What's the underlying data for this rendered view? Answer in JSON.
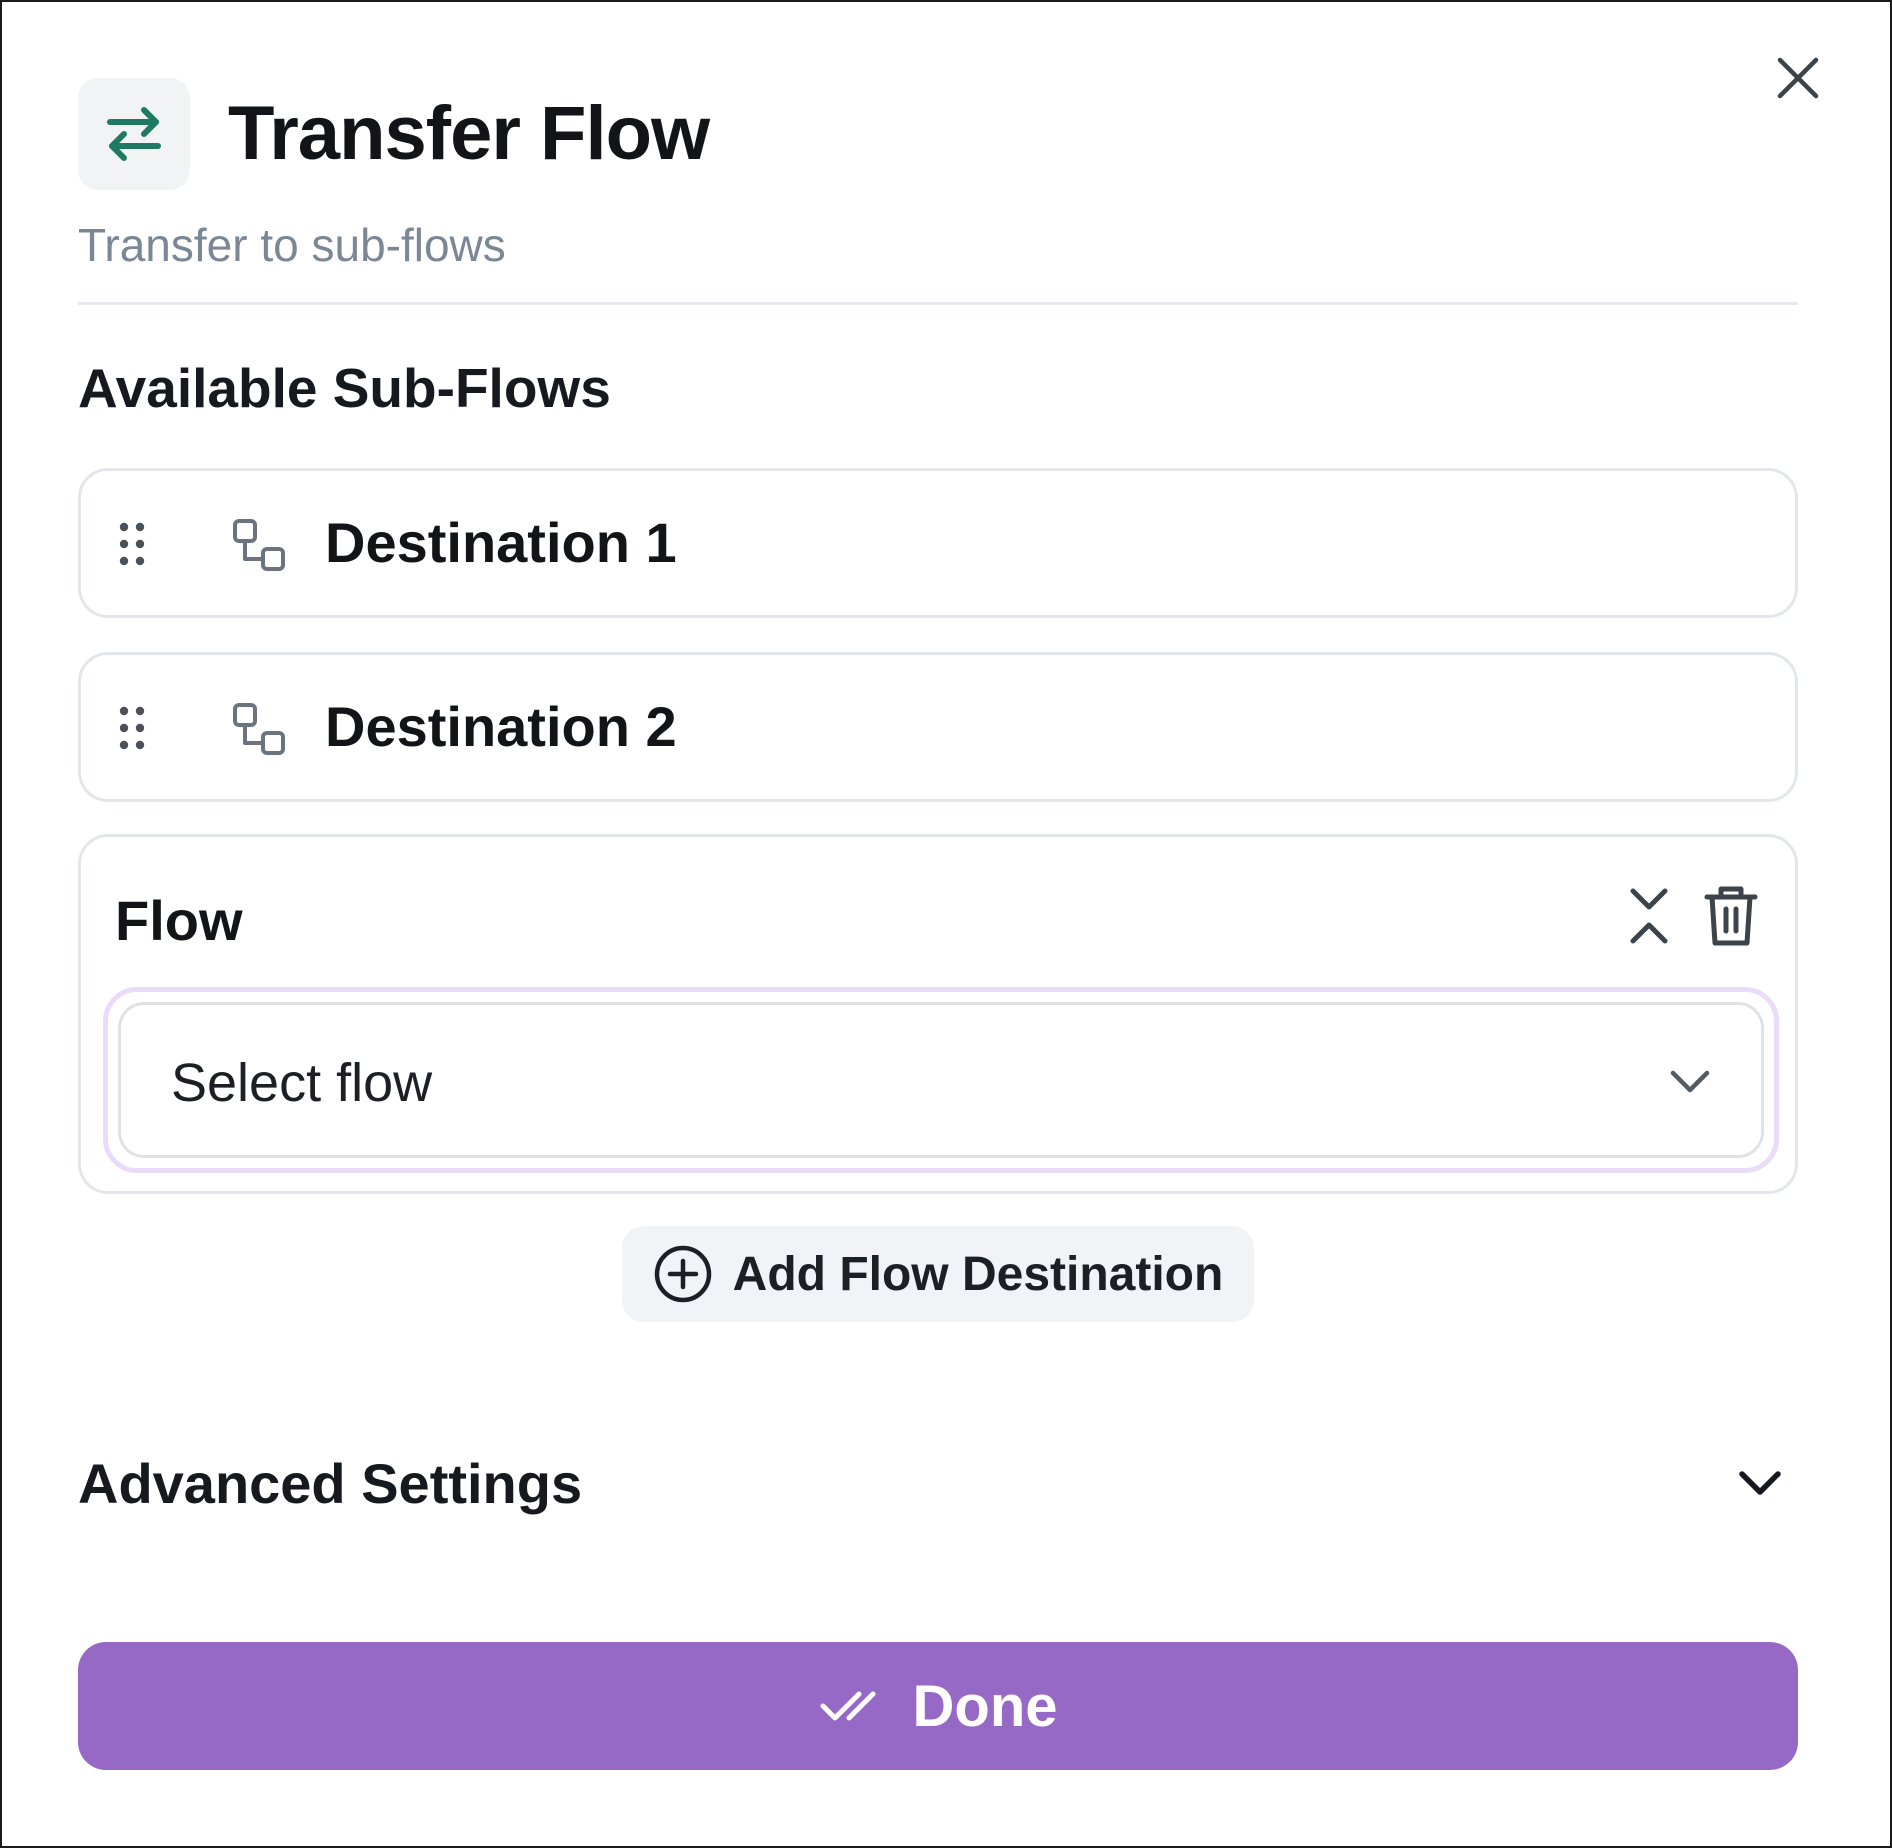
{
  "header": {
    "title": "Transfer Flow",
    "subtitle": "Transfer to sub-flows",
    "icon": "arrows-left-right-icon",
    "icon_color": "#1e7a62"
  },
  "sections": {
    "available_title": "Available Sub-Flows"
  },
  "destinations": [
    {
      "label": "Destination 1",
      "icon": "flow-nodes-icon"
    },
    {
      "label": "Destination 2",
      "icon": "flow-nodes-icon"
    }
  ],
  "flow_card": {
    "title": "Flow",
    "select_placeholder": "Select flow"
  },
  "add_button": {
    "label": "Add Flow Destination",
    "icon": "plus-circle-icon"
  },
  "advanced": {
    "title": "Advanced Settings"
  },
  "done_button": {
    "label": "Done",
    "icon": "double-check-icon"
  },
  "colors": {
    "accent": "#9669c7",
    "focus_ring": "#eadcf9",
    "text_primary": "#121417",
    "text_muted": "#7b8794"
  }
}
